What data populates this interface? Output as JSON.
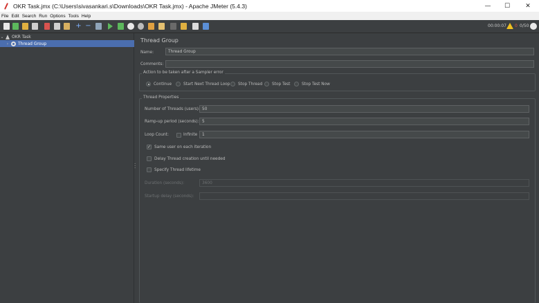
{
  "window": {
    "title": "OKR Task.jmx (C:\\Users\\sivasankari.s\\Downloads\\OKR Task.jmx) - Apache JMeter (5.4.3)",
    "minimize": "—",
    "maximize": "☐",
    "close": "✕"
  },
  "menu": [
    "File",
    "Edit",
    "Search",
    "Run",
    "Options",
    "Tools",
    "Help"
  ],
  "toolbar": {
    "timer": "00:00:07",
    "warnings": "0",
    "threads": "0/50"
  },
  "tree": {
    "root": "OKR Task",
    "child": "Thread Group"
  },
  "panel": {
    "title": "Thread Group",
    "name_label": "Name:",
    "name_value": "Thread Group",
    "comments_label": "Comments:",
    "comments_value": "",
    "sampler_error": {
      "title": "Action to be taken after a Sampler error",
      "options": [
        "Continue",
        "Start Next Thread Loop",
        "Stop Thread",
        "Stop Test",
        "Stop Test Now"
      ],
      "selected": "Continue"
    },
    "thread_props": {
      "title": "Thread Properties",
      "threads_label": "Number of Threads (users):",
      "threads_value": "50",
      "rampup_label": "Ramp-up period (seconds):",
      "rampup_value": "5",
      "loop_label": "Loop Count:",
      "infinite_label": "Infinite",
      "loop_value": "1",
      "same_user_label": "Same user on each iteration",
      "delay_label": "Delay Thread creation until needed",
      "lifetime_label": "Specify Thread lifetime",
      "duration_label": "Duration (seconds):",
      "duration_value": "3600",
      "startup_label": "Startup delay (seconds):",
      "startup_value": ""
    }
  },
  "colors": {
    "background": "#3c3f41",
    "selection": "#4b6eaf",
    "field": "#45494a"
  }
}
